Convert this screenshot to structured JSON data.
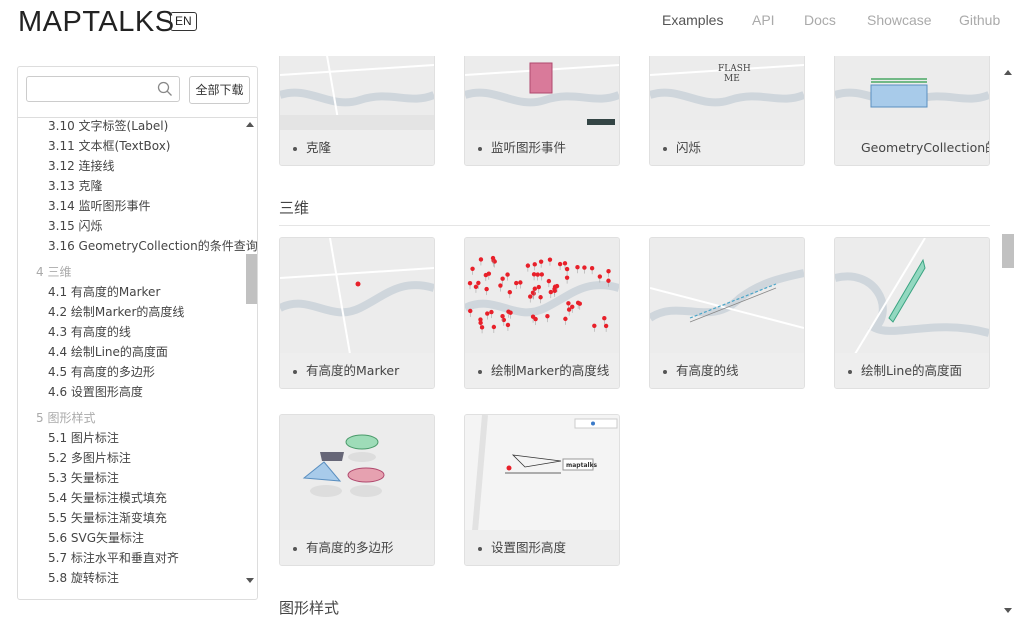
{
  "header": {
    "logo": "MAPTALKS",
    "lang": "EN",
    "nav": [
      "Examples",
      "API",
      "Docs",
      "Showcase",
      "Github"
    ]
  },
  "sidebar": {
    "search_placeholder": "",
    "download_label": "全部下载",
    "items": [
      {
        "type": "item",
        "label": "3.10 文字标签(Label)"
      },
      {
        "type": "item",
        "label": "3.11 文本框(TextBox)"
      },
      {
        "type": "item",
        "label": "3.12 连接线"
      },
      {
        "type": "item",
        "label": "3.13 克隆"
      },
      {
        "type": "item",
        "label": "3.14 监听图形事件"
      },
      {
        "type": "item",
        "label": "3.15 闪烁"
      },
      {
        "type": "item",
        "label": "3.16 GeometryCollection的条件查询"
      },
      {
        "type": "section",
        "label": "4 三维"
      },
      {
        "type": "item",
        "label": "4.1 有高度的Marker"
      },
      {
        "type": "item",
        "label": "4.2 绘制Marker的高度线"
      },
      {
        "type": "item",
        "label": "4.3 有高度的线"
      },
      {
        "type": "item",
        "label": "4.4 绘制Line的高度面"
      },
      {
        "type": "item",
        "label": "4.5 有高度的多边形"
      },
      {
        "type": "item",
        "label": "4.6 设置图形高度"
      },
      {
        "type": "section",
        "label": "5 图形样式"
      },
      {
        "type": "item",
        "label": "5.1 图片标注"
      },
      {
        "type": "item",
        "label": "5.2 多图片标注"
      },
      {
        "type": "item",
        "label": "5.3 矢量标注"
      },
      {
        "type": "item",
        "label": "5.4 矢量标注模式填充"
      },
      {
        "type": "item",
        "label": "5.5 矢量标注渐变填充"
      },
      {
        "type": "item",
        "label": "5.6 SVG矢量标注"
      },
      {
        "type": "item",
        "label": "5.7 标注水平和垂直对齐"
      },
      {
        "type": "item",
        "label": "5.8 旋转标注"
      }
    ]
  },
  "content": {
    "row0": [
      "克隆",
      "监听图形事件",
      "闪烁",
      "GeometryCollection的条件查询"
    ],
    "section3d": "三维",
    "row1": [
      "有高度的Marker",
      "绘制Marker的高度线",
      "有高度的线",
      "绘制Line的高度面"
    ],
    "row2": [
      "有高度的多边形",
      "设置图形高度"
    ],
    "section_style": "图形样式"
  },
  "thumb_text": {
    "flash": "FLASH",
    "flash2": "ME",
    "maptalks": "maptalks"
  },
  "colors": {
    "marker_red": "#e8202a",
    "map_bg": "#ececec",
    "river": "#c7cfd6"
  }
}
